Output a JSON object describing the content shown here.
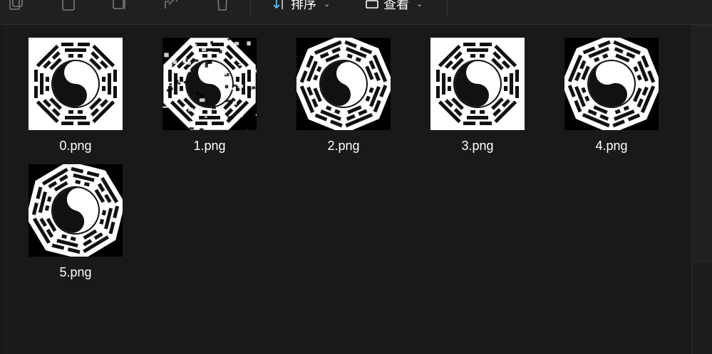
{
  "toolbar": {
    "sort_label": "排序",
    "view_label": "查看",
    "icons": [
      "copy-icon",
      "paste-icon",
      "rename-icon",
      "share-icon",
      "delete-icon",
      "sort-icon",
      "view-icon",
      "more-icon"
    ]
  },
  "files": [
    {
      "name": "0.png",
      "style": "white-octagon"
    },
    {
      "name": "1.png",
      "style": "noisy"
    },
    {
      "name": "2.png",
      "style": "rotated"
    },
    {
      "name": "3.png",
      "style": "white-octagon"
    },
    {
      "name": "4.png",
      "style": "rotated-b"
    },
    {
      "name": "5.png",
      "style": "rotated-c"
    }
  ],
  "colors": {
    "background": "#191919",
    "toolbar": "#202020",
    "text": "#ffffff",
    "accent": "#4cc2ff"
  }
}
